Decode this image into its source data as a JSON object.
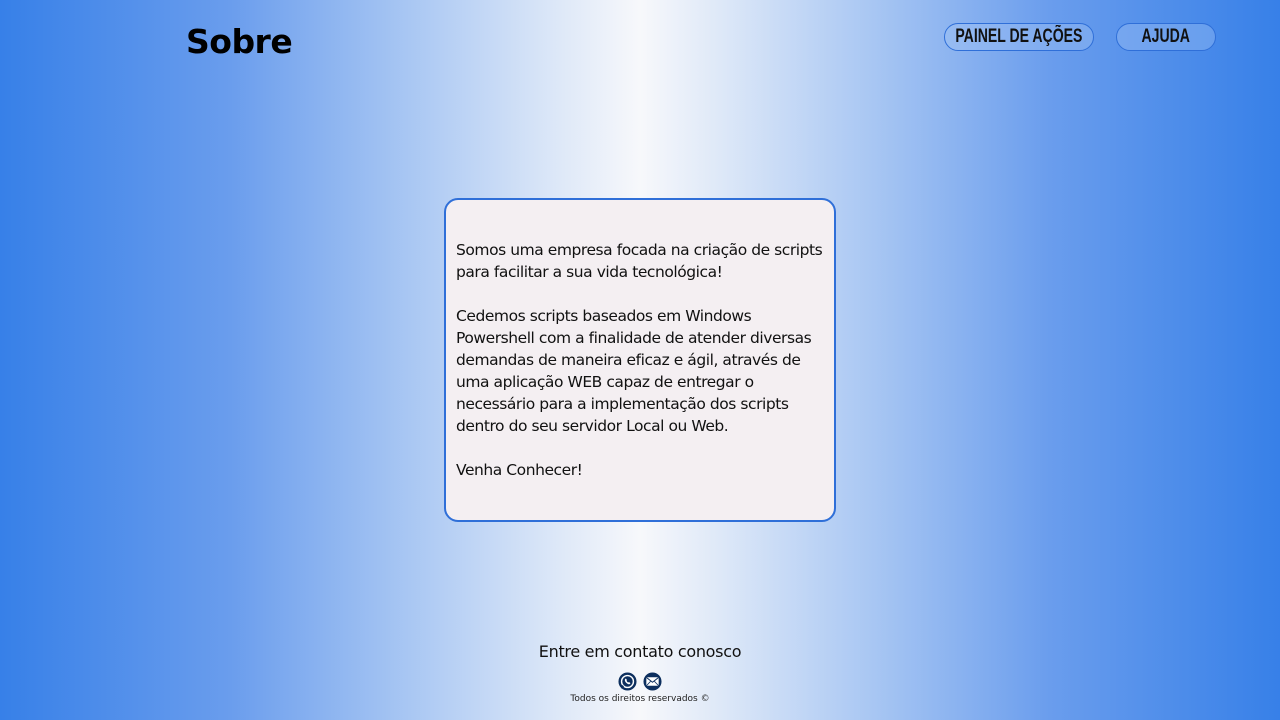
{
  "header": {
    "title": "Sobre",
    "nav": [
      {
        "label": "PAINEL DE AÇÕES"
      },
      {
        "label": "AJUDA"
      }
    ]
  },
  "about": {
    "paragraphs": [
      "Somos uma empresa focada na criação de scripts\npara facilitar a sua vida tecnológica!",
      "Cedemos scripts baseados em Windows\nPowershell com a finalidade de atender diversas\ndemandas de maneira eficaz e ágil, através de\numa aplicação WEB capaz de entregar o\nnecessário para a implementação dos scripts\ndentro do seu servidor Local ou Web.",
      "Venha Conhecer!"
    ]
  },
  "footer": {
    "contact_label": "Entre em contato conosco",
    "icons": [
      "whatsapp-icon",
      "email-icon"
    ],
    "copyright": "Todos os direitos reservados ©"
  },
  "colors": {
    "accent": "#2f6fd8",
    "card_background": "#f4eff2",
    "gradient_edge": "#3780e8",
    "gradient_center": "#f7f8fb"
  }
}
